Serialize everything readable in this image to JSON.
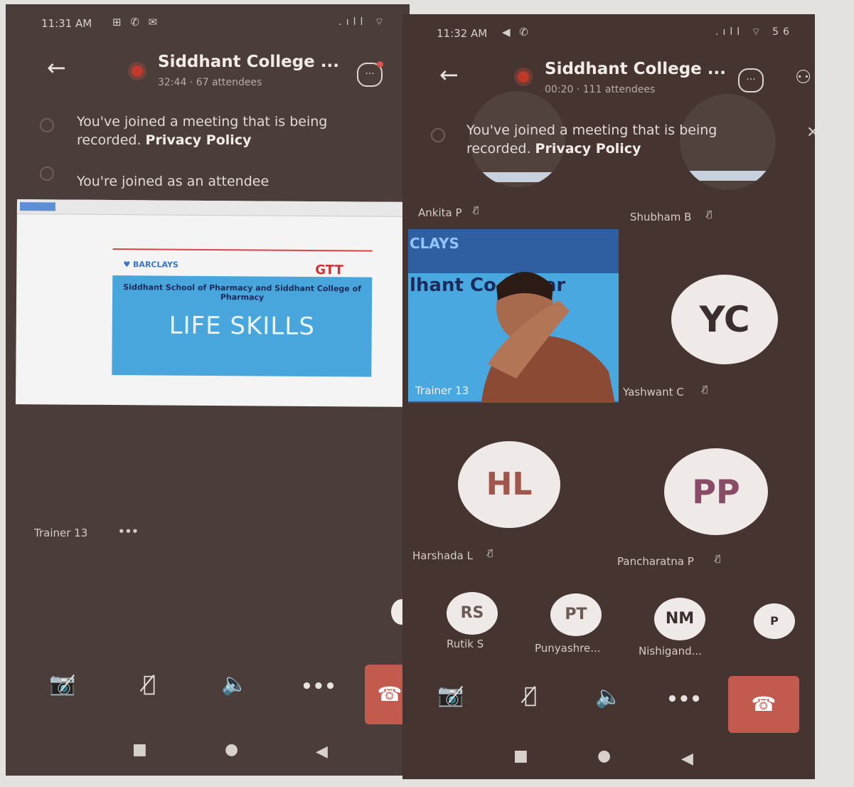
{
  "left": {
    "status_time": "11:31 AM",
    "status_icons": "⊞ ✆ ✉",
    "status_right": ".ıll ⌔",
    "title": "Siddhant College ...",
    "subtitle": "32:44 · 67 attendees",
    "notice_recorded": "You've joined a meeting that is being recorded.",
    "privacy_link": "Privacy Policy",
    "notice_attendee": "You're joined as an attendee",
    "slide": {
      "brand": "♥ BARCLAYS",
      "logo": "GTT",
      "heading": "Siddhant School of Pharmacy and Siddhant College of Pharmacy",
      "title": "LIFE SKILLS"
    },
    "presenter": "Trainer 13",
    "presenter_more": "•••"
  },
  "right": {
    "status_time": "11:32 AM",
    "status_icons": "◀ ✆",
    "status_right": ".ıll ⌔ 56",
    "title": "Siddhant College ...",
    "subtitle": "00:20 · 111 attendees",
    "notice_recorded": "You've joined a meeting that is being recorded.",
    "privacy_link": "Privacy Policy",
    "participants": {
      "ankita": "Ankita P",
      "shubham": "Shubham B",
      "trainer_video_label": "Trainer 13",
      "trainer_video_t1": "CLAYS",
      "trainer_video_t2": "lhant Co     f Phar",
      "yc_initials": "YC",
      "yc_name": "Yashwant C",
      "hl_initials": "HL",
      "hl_name": "Harshada L",
      "pp_initials": "PP",
      "pp_name": "Pancharatna P",
      "rs_initials": "RS",
      "rs_name": "Rutik S",
      "pt_initials": "PT",
      "pt_name": "Punyashre...",
      "nm_initials": "NM",
      "nm_name": "Nishigand...",
      "p_initials": "P"
    }
  },
  "controls": {
    "camera": "📷̸",
    "mic": "🎙̸",
    "speaker": "🔈",
    "more": "•••",
    "end": "☎"
  },
  "muted_glyph": "🎙̸",
  "nav": {
    "recent": "■",
    "home": "●",
    "back": "◀"
  },
  "colors": {
    "end_call": "#c25a4d",
    "recording": "#c0392b",
    "avatar_text": "#a1564c",
    "slide_blue": "#48a6dc"
  }
}
